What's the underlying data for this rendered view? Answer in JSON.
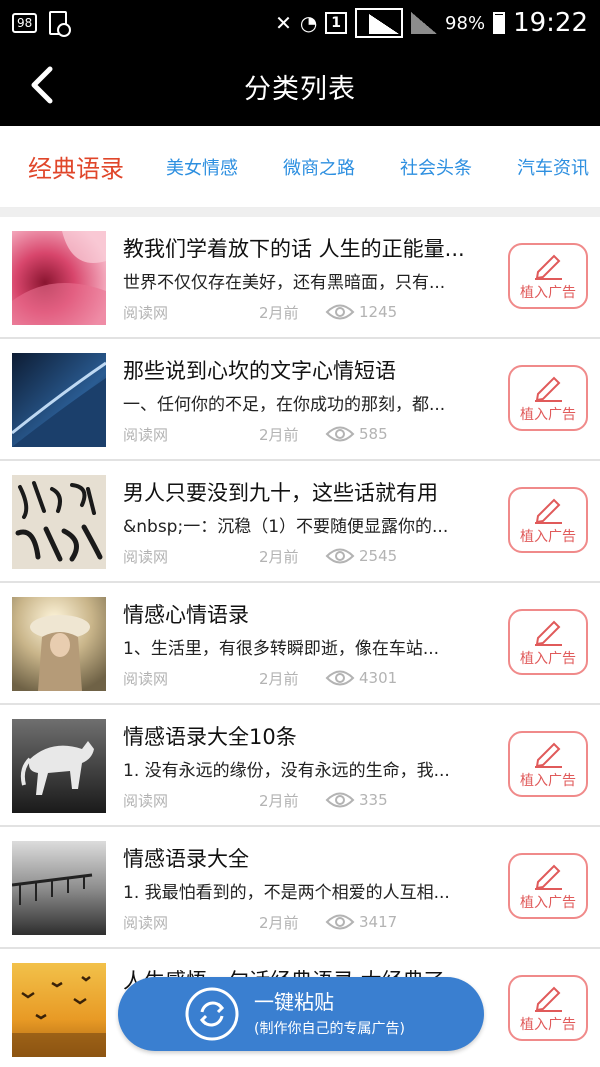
{
  "status_bar": {
    "notification_count": "98",
    "sim_label": "1",
    "battery": "98%",
    "time": "19:22"
  },
  "header": {
    "title": "分类列表"
  },
  "tabs": [
    {
      "label": "经典语录",
      "active": true
    },
    {
      "label": "美女情感",
      "active": false
    },
    {
      "label": "微商之路",
      "active": false
    },
    {
      "label": "社会头条",
      "active": false
    },
    {
      "label": "汽车资讯",
      "active": false
    }
  ],
  "articles": [
    {
      "title": "教我们学着放下的话 人生的正能量...",
      "desc": "世界不仅仅存在美好，还有黑暗面，只有...",
      "source": "阅读网",
      "time": "2月前",
      "views": "1245",
      "thumb": "pink-flower"
    },
    {
      "title": "那些说到心坎的文字心情短语",
      "desc": "一、任何你的不足，在你成功的那刻，都...",
      "source": "阅读网",
      "time": "2月前",
      "views": "585",
      "thumb": "planet-horizon"
    },
    {
      "title": "男人只要没到九十，这些话就有用",
      "desc": "&nbsp;一：沉稳（1）不要随便显露你的...",
      "source": "阅读网",
      "time": "2月前",
      "views": "2545",
      "thumb": "calligraphy"
    },
    {
      "title": "情感心情语录",
      "desc": "1、生活里，有很多转瞬即逝，像在车站...",
      "source": "阅读网",
      "time": "2月前",
      "views": "4301",
      "thumb": "girl-hat"
    },
    {
      "title": "情感语录大全10条",
      "desc": "1. 没有永远的缘份，没有永远的生命，我...",
      "source": "阅读网",
      "time": "2月前",
      "views": "335",
      "thumb": "horse"
    },
    {
      "title": "情感语录大全",
      "desc": "1. 我最怕看到的，不是两个相爱的人互相...",
      "source": "阅读网",
      "time": "2月前",
      "views": "3417",
      "thumb": "pier"
    },
    {
      "title": "人生感悟一句话经典语录 太经典了",
      "desc": "",
      "source": "",
      "time": "",
      "views": "",
      "thumb": "birds-sunset"
    }
  ],
  "ad_button_label": "植入广告",
  "float_button": {
    "main": "一键粘贴",
    "sub": "(制作你自己的专属广告)"
  },
  "colors": {
    "tab_active": "#e0462a",
    "tab_inactive": "#2d8fe0",
    "ad_border": "#f08a8a",
    "float_button": "#3a7fd0"
  }
}
